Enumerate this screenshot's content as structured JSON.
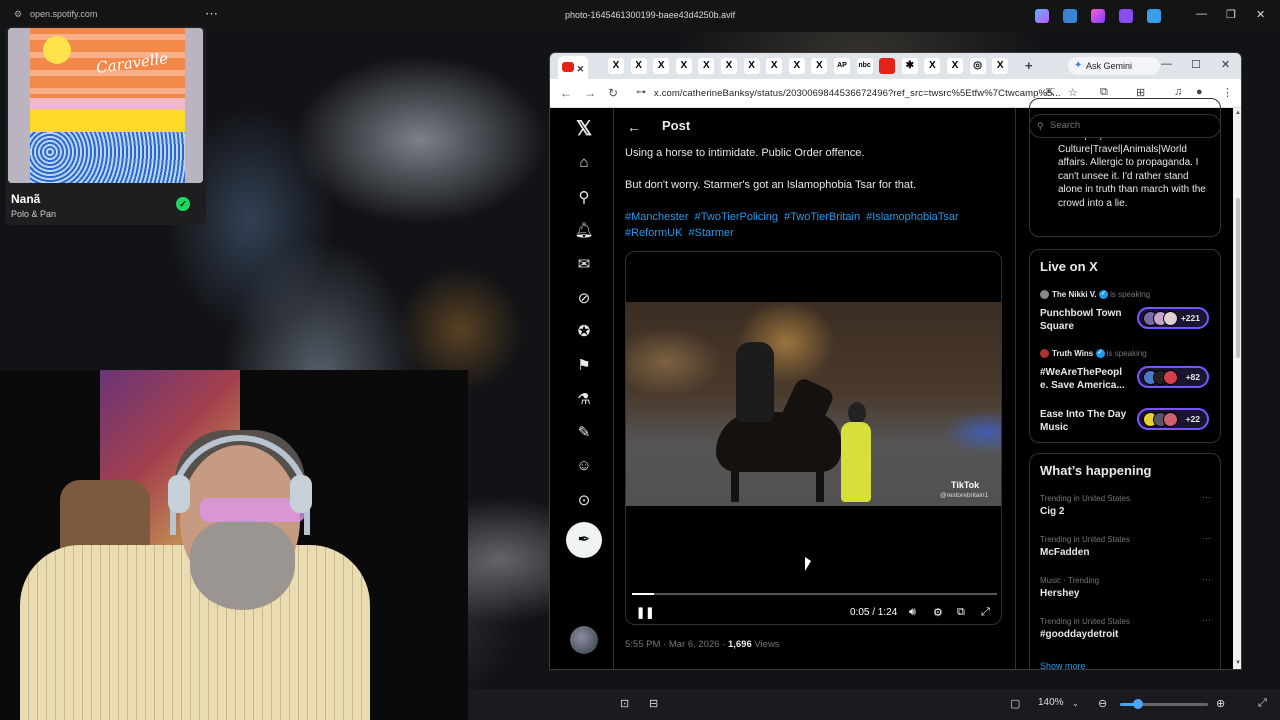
{
  "os": {
    "window_title": "photo-1645461300199-baee43d4250b.avif",
    "spotify_url": "open.spotify.com",
    "more": "⋯",
    "zoom_level": "140%",
    "minimize": "—",
    "restore": "❐",
    "close": "✕"
  },
  "spotify": {
    "track_title": "Nanã",
    "artist": "Polo & Pan",
    "album_script": "Caravelle"
  },
  "browser": {
    "ask_gemini": "Ask Gemini",
    "url": "x.com/catherineBanksy/status/2030069844536672496?ref_src=twsrc%5Etfw%7Ctwcamp%5...",
    "tabs": [
      "X",
      "X",
      "X",
      "X",
      "X",
      "X",
      "X",
      "X",
      "X",
      "X",
      "AP",
      "nbc",
      "yt",
      "✱",
      "X",
      "X",
      "◎",
      "X"
    ],
    "new_tab": "+"
  },
  "x": {
    "header_title": "Post",
    "post_lines": [
      "Using a horse to intimidate. Public Order offence.",
      "But don't worry. Starmer's got an Islamophobia Tsar for that."
    ],
    "hashtags": [
      "#Manchester",
      "#TwoTierPolicing",
      "#TwoTierBritain",
      "#IslamophobiaTsar",
      "#ReformUK",
      "#Starmer"
    ],
    "video": {
      "watermark": "TikTok",
      "handle": "@restorebritain1",
      "time": "0:05 / 1:24",
      "progress": 0.06
    },
    "meta": {
      "time": "5:55 PM · Mar 6, 2026 · ",
      "views_count": "1,696",
      "views_label": " Views"
    },
    "search_placeholder": "Search",
    "bio": "Music|Art| Culture|Travel|Animals|World affairs. Allergic to propaganda. I can't unsee it. I'd rather stand alone in truth than march with the crowd into a lie.",
    "live": {
      "title": "Live on X",
      "items": [
        {
          "host": "The Nikki V.",
          "speaking": "is speaking",
          "title": "Punchbowl Town Square",
          "count": "+221"
        },
        {
          "host": "Truth Wins",
          "speaking": "is speaking",
          "title": "#WeAreThePeopl e. Save America...",
          "count": "+82"
        },
        {
          "host": "",
          "speaking": "",
          "title": "Ease Into The Day Music",
          "count": "+22"
        }
      ]
    },
    "happening": {
      "title": "What’s happening",
      "trends": [
        {
          "category": "Trending in United States",
          "name": "Cig 2"
        },
        {
          "category": "Trending in United States",
          "name": "McFadden"
        },
        {
          "category": "Music · Trending",
          "name": "Hershey"
        },
        {
          "category": "Trending in United States",
          "name": "#gooddaydetroit"
        }
      ],
      "show_more": "Show more"
    }
  }
}
